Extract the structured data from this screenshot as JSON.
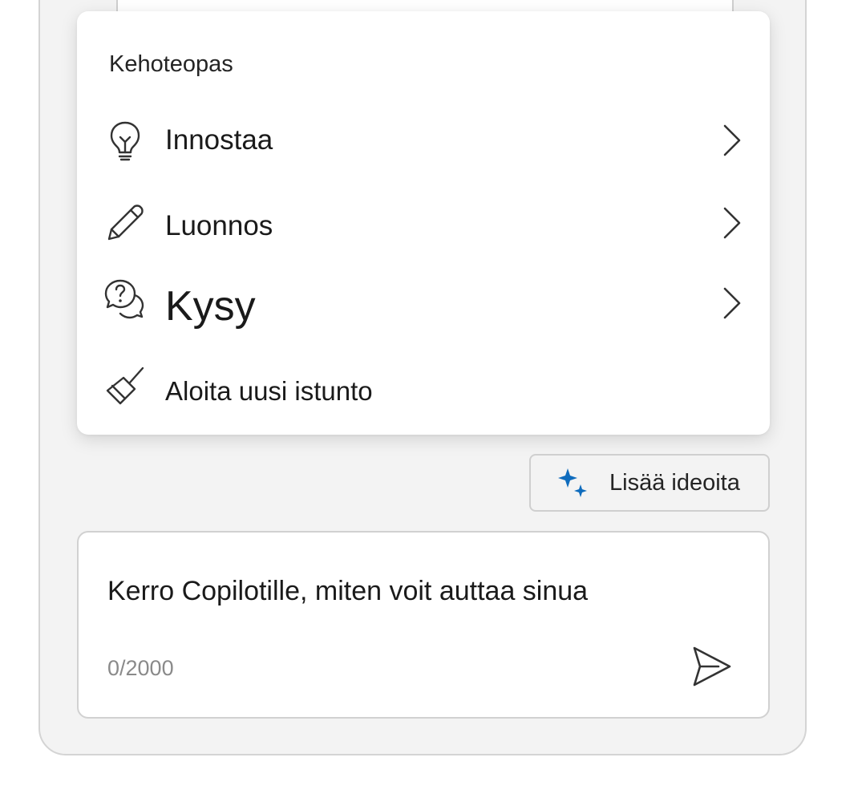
{
  "menu": {
    "title": "Kehoteopas",
    "items": [
      {
        "label": "Innostaa",
        "icon": "lightbulb-icon",
        "has_submenu": true
      },
      {
        "label": "Luonnos",
        "icon": "pencil-icon",
        "has_submenu": true
      },
      {
        "label": "Kysy",
        "icon": "question-chat-icon",
        "has_submenu": true
      },
      {
        "label": "Aloita uusi istunto",
        "icon": "broom-icon",
        "has_submenu": false
      }
    ]
  },
  "ideas_button": {
    "label": "Lisää ideoita",
    "icon": "sparkle-icon"
  },
  "composer": {
    "placeholder": "Kerro Copilotille, miten voit auttaa sinua",
    "counter": "0/2000",
    "send_icon": "send-icon"
  },
  "colors": {
    "accent": "#0f6cbd",
    "pane_bg": "#f3f3f3",
    "card_bg": "#ffffff",
    "text": "#1a1a1a",
    "muted": "#8a8a8a"
  }
}
